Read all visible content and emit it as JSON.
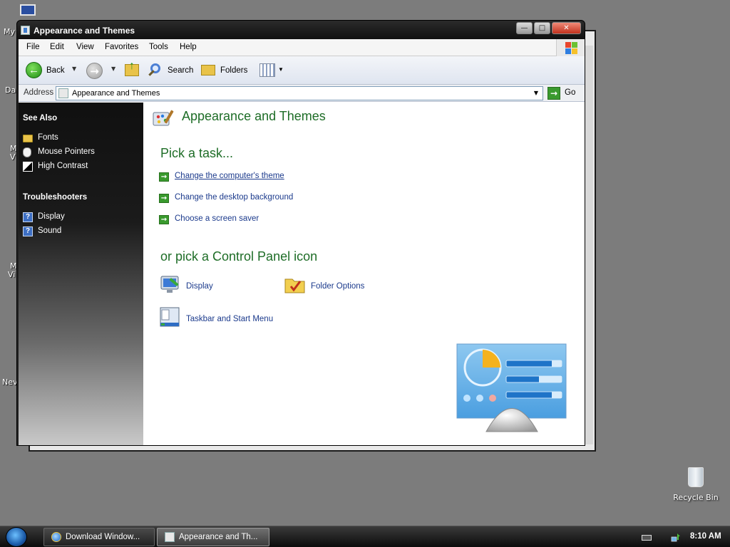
{
  "desktop": {
    "recycle_bin_label": "Recycle Bin",
    "partial_labels": [
      "My",
      "Da",
      "M",
      "V",
      "M",
      "Vi",
      "Nev"
    ]
  },
  "window": {
    "title": "Appearance and Themes",
    "controls": {
      "minimize": "—",
      "maximize": "□",
      "close": "✕"
    }
  },
  "menu": [
    "File",
    "Edit",
    "View",
    "Favorites",
    "Tools",
    "Help"
  ],
  "toolbar": {
    "back": "Back",
    "search": "Search",
    "folders": "Folders"
  },
  "address": {
    "label": "Address",
    "value": "Appearance and Themes",
    "go": "Go"
  },
  "sidebar": {
    "see_also": {
      "heading": "See Also",
      "items": [
        {
          "label": "Fonts",
          "icon": "folder-icon"
        },
        {
          "label": "Mouse Pointers",
          "icon": "mouse-icon"
        },
        {
          "label": "High Contrast",
          "icon": "contrast-icon"
        }
      ]
    },
    "troubleshooters": {
      "heading": "Troubleshooters",
      "items": [
        {
          "label": "Display",
          "icon": "help-icon"
        },
        {
          "label": "Sound",
          "icon": "help-icon"
        }
      ]
    }
  },
  "main": {
    "title": "Appearance and Themes",
    "pick_task": "Pick a task...",
    "tasks": [
      "Change the computer's theme",
      "Change the desktop background",
      "Choose a screen saver"
    ],
    "pick_icon": "or pick a Control Panel icon",
    "icons": [
      {
        "label": "Display",
        "icon": "display-icon"
      },
      {
        "label": "Folder Options",
        "icon": "folder-options-icon"
      },
      {
        "label": "Taskbar and Start Menu",
        "icon": "taskbar-icon"
      }
    ]
  },
  "taskbar": {
    "buttons": [
      {
        "label": "Download Window...",
        "active": false
      },
      {
        "label": "Appearance and Th...",
        "active": true
      }
    ],
    "clock": "8:10 AM"
  },
  "colors": {
    "heading_green": "#1e6d27",
    "link_blue": "#1b3a8c",
    "sidebar_dark": "#111111",
    "close_red": "#c1301c"
  }
}
